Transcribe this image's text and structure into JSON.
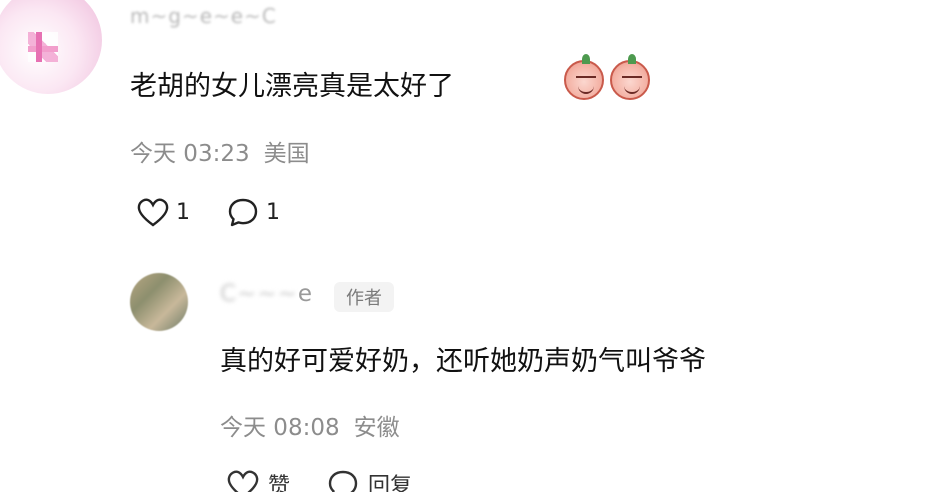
{
  "top_comment": {
    "username": "m~g~e~e~C",
    "text": "老胡的女儿漂亮真是太好了",
    "emojis": [
      "peach-face-icon",
      "peach-face-icon"
    ],
    "time": "今天 03:23",
    "location": "美国",
    "like_count": "1",
    "reply_count": "1"
  },
  "reply": {
    "username_blurred": "C~~~",
    "username_suffix": "e",
    "author_badge": "作者",
    "text": "真的好可爱好奶，还听她奶声奶气叫爷爷",
    "time": "今天 08:08",
    "location": "安徽",
    "like_label": "赞",
    "reply_label": "回复"
  },
  "colors": {
    "text_primary": "#111111",
    "text_meta": "#8c8c8c",
    "badge_bg": "#f3f3f3"
  }
}
